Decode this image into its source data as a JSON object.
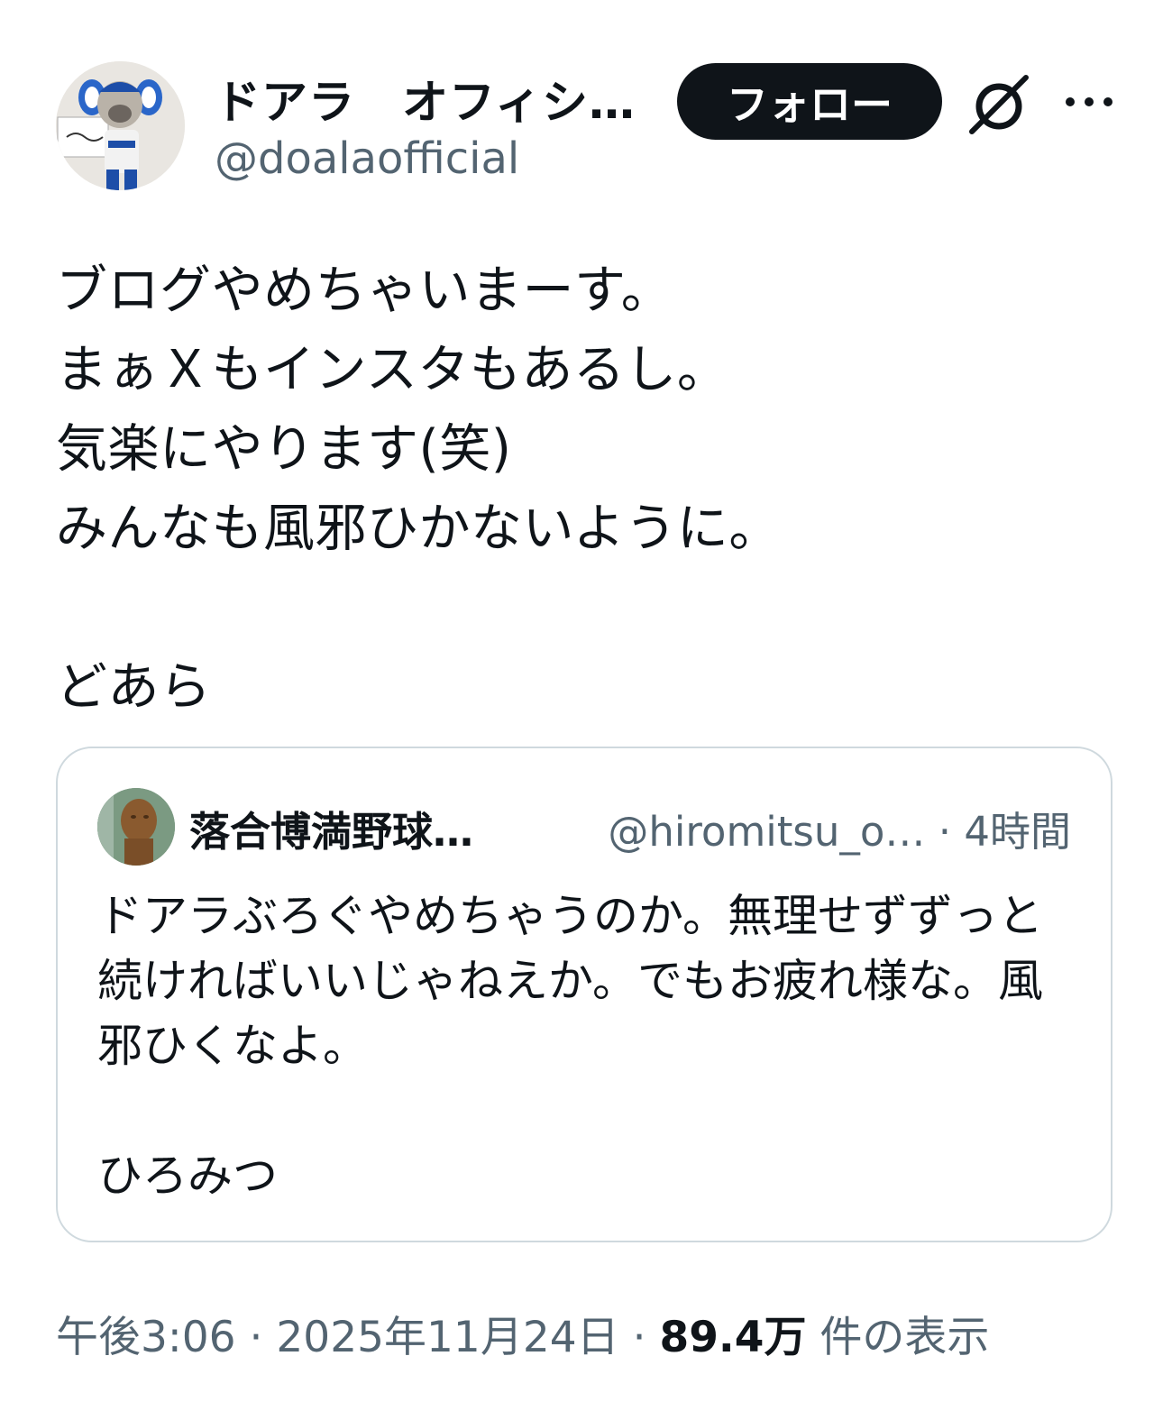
{
  "author": {
    "display_name": "ドアラ　オフィシ…",
    "handle": "@doalaofficial",
    "avatar_icon": "mascot-avatar"
  },
  "actions": {
    "follow_label": "フォロー",
    "grok_icon": "grok-icon",
    "more_icon": "more-icon"
  },
  "tweet": {
    "text": "ブログやめちゃいまーす。\nまぁＸもインスタもあるし。\n気楽にやります(笑)\nみんなも風邪ひかないように。\n\nどあら"
  },
  "quote": {
    "display_name": "落合博満野球…",
    "handle": "@hiromitsu_o…",
    "separator": "·",
    "time": "4時間",
    "text": "ドアラぶろぐやめちゃうのか。無理せずずっと続ければいいじゃねえか。でもお疲れ様な。風邪ひくなよ。\n\nひろみつ"
  },
  "footer": {
    "time": "午後3:06",
    "sep1": "·",
    "date": "2025年11月24日",
    "sep2": "·",
    "views": "89.4万",
    "views_suffix": "件の表示"
  },
  "colors": {
    "text": "#0f1419",
    "secondary": "#536471",
    "border": "#cfd9de",
    "follow_bg": "#0f1419"
  }
}
